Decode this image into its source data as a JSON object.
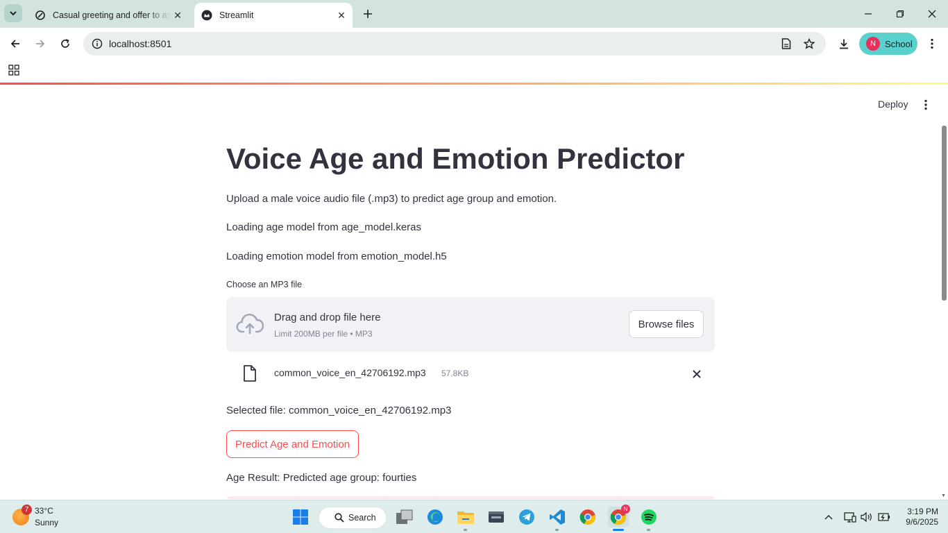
{
  "browser": {
    "tabs": [
      {
        "title": "Casual greeting and offer to assist",
        "active": false
      },
      {
        "title": "Streamlit",
        "active": true
      }
    ],
    "url": "localhost:8501",
    "profile": {
      "initial": "N",
      "name": "School"
    }
  },
  "app": {
    "deploy_label": "Deploy",
    "title": "Voice Age and Emotion Predictor",
    "intro": "Upload a male voice audio file (.mp3) to predict age group and emotion.",
    "status_lines": [
      "Loading age model from age_model.keras",
      "Loading emotion model from emotion_model.h5"
    ],
    "uploader": {
      "label": "Choose an MP3 file",
      "drop_title": "Drag and drop file here",
      "drop_subtitle": "Limit 200MB per file • MP3",
      "browse_label": "Browse files",
      "file": {
        "name": "common_voice_en_42706192.mp3",
        "size": "57.8KB"
      }
    },
    "selected_file_text": "Selected file: common_voice_en_42706192.mp3",
    "predict_button": "Predict Age and Emotion",
    "age_result": "Age Result: Predicted age group: fourties",
    "accent_color": "#ff4b4b"
  },
  "taskbar": {
    "weather": {
      "badge": "7",
      "temp": "33°C",
      "desc": "Sunny"
    },
    "search_label": "Search",
    "time": "3:19 PM",
    "date": "9/6/2025",
    "chrome_badge": "N"
  }
}
